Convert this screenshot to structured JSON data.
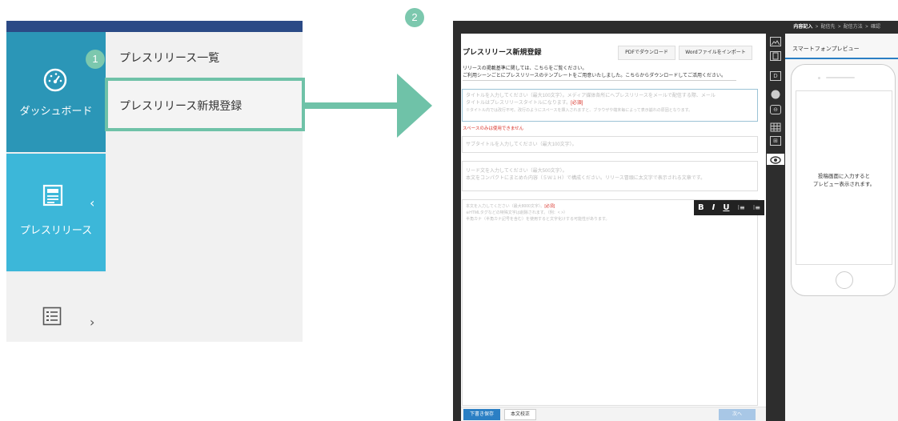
{
  "left_panel": {
    "step_badge": "1",
    "sidebar": {
      "dashboard_label": "ダッシュボード",
      "pressrelease_label": "プレスリリース",
      "chevron_left": "‹",
      "chevron_right": "›"
    },
    "submenu": {
      "item_list": "プレスリリース一覧",
      "item_new": "プレスリリース新規登録"
    }
  },
  "right_panel": {
    "step_badge": "2",
    "breadcrumbs": {
      "current": "内容記入",
      "sep": ">",
      "step2": "配信先",
      "step3": "配信方法",
      "step4": "確認"
    },
    "form": {
      "title": "プレスリリース新規登録",
      "pdf_button": "PDFでダウンロード",
      "word_button": "Wordファイルをインポート",
      "intro_line1": "リリースの掲載基準に関しては、こちらをご覧ください。",
      "intro_line2": "ご利用シーンごとにプレスリリースのテンプレートをご用意いたしました。こちらからダウンロードしてご活用ください。",
      "title_placeholder_1": "タイトルを入力してください（最大100文字）。メディア媒体各所にへプレスリリースをメールで配信する際、メール",
      "title_placeholder_2": "タイトルはプレスリリースタイトルになります。",
      "required_tag": "[必須]",
      "title_note": "※タイトル内では改行不可。改行のようにスペースを挿入されますと、ブラウザや端末毎によって表示崩れの原因となります。",
      "space_error": "スペースのみは使用できません",
      "subtitle_placeholder": "サブタイトルを入力してください（最大100文字）。",
      "lead_placeholder_1": "リード文を入力してください（最大500文字）。",
      "lead_placeholder_2": "本文をコンパクトにまとめた内容（５Ｗ１Ｈ）で構成ください。リリース冒頭に太文字で表示される文章です。",
      "body_placeholder_1": "本文を入力してください（最大8000文字）。",
      "body_note_1": "※HTMLタグなどの特殊文字は削除されます。（例：< >）",
      "body_note_2": "半角カナ（半角カナ記号を含む）を使用すると文字化けする可能性があります。",
      "save_draft_button": "下書き保存",
      "proofread_button": "本文校正",
      "next_button": "次へ"
    },
    "editor_toolbar": {
      "bold": "B",
      "italic": "I",
      "underline": "U",
      "ordered_list": "⁝≡",
      "bullet_list": "⁝≡"
    },
    "preview": {
      "heading": "スマートフォンプレビュー",
      "message_line1": "投稿画面に入力すると",
      "message_line2": "プレビュー表示されます。"
    },
    "icons": [
      "image-icon",
      "document-icon",
      "d-box-icon",
      "gif-icon",
      "link-icon",
      "table-icon",
      "embed-icon",
      "eye-icon"
    ]
  }
}
